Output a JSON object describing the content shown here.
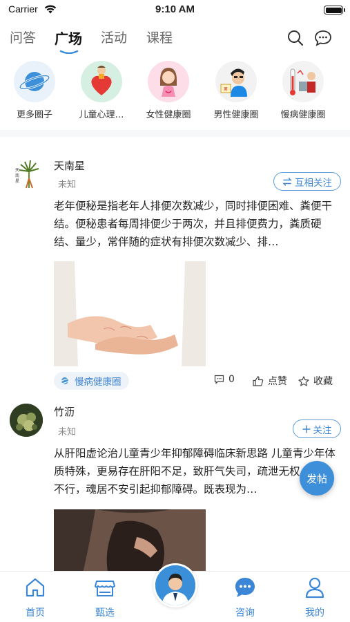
{
  "status_bar": {
    "carrier": "Carrier",
    "time": "9:10 AM"
  },
  "top_nav": {
    "tabs": [
      {
        "label": "问答"
      },
      {
        "label": "广场"
      },
      {
        "label": "活动"
      },
      {
        "label": "课程"
      }
    ],
    "active_tab": "广场",
    "icons": [
      "search-icon",
      "message-icon"
    ]
  },
  "circles": [
    {
      "label": "更多圈子",
      "icon": "planet-icon"
    },
    {
      "label": "儿童心理…",
      "icon": "child-heart-illustration"
    },
    {
      "label": "女性健康圈",
      "icon": "woman-illustration"
    },
    {
      "label": "男性健康圈",
      "icon": "man-illustration"
    },
    {
      "label": "慢病健康圈",
      "icon": "blood-pressure-illustration"
    }
  ],
  "posts": [
    {
      "username": "天南星",
      "role": "未知",
      "follow_label": "互相关注",
      "follow_icon": "swap-icon",
      "text": "老年便秘是指老年人排便次数减少，同时排便困难、粪便干结。便秘患者每周排便少于两次，并且排便费力，粪质硬结、量少，常伴随的症状有排便次数减少、排…",
      "tag": "慢病健康圈",
      "comments": "0",
      "like_label": "点赞",
      "collect_label": "收藏"
    },
    {
      "username": "竹沥",
      "role": "未知",
      "follow_label": "关注",
      "follow_icon": "plus-icon",
      "text": "从肝阳虚论治儿童青少年抑郁障碍临床新思路 儿童青少年体质特殊，更易存在肝阳不足，致肝气失司，疏泄无权，肝血不行，魂居不安引起抑郁障碍。既表现为…"
    }
  ],
  "fab_label": "发帖",
  "tabbar": [
    {
      "label": "首页",
      "icon": "home-icon"
    },
    {
      "label": "甄选",
      "icon": "store-icon"
    },
    {
      "label": "咨询",
      "icon": "chat-bubble-icon"
    },
    {
      "label": "我的",
      "icon": "user-icon"
    }
  ],
  "colors": {
    "accent": "#3d8fd9",
    "text": "#222222",
    "muted": "#888888",
    "background": "#f6f7f9"
  }
}
